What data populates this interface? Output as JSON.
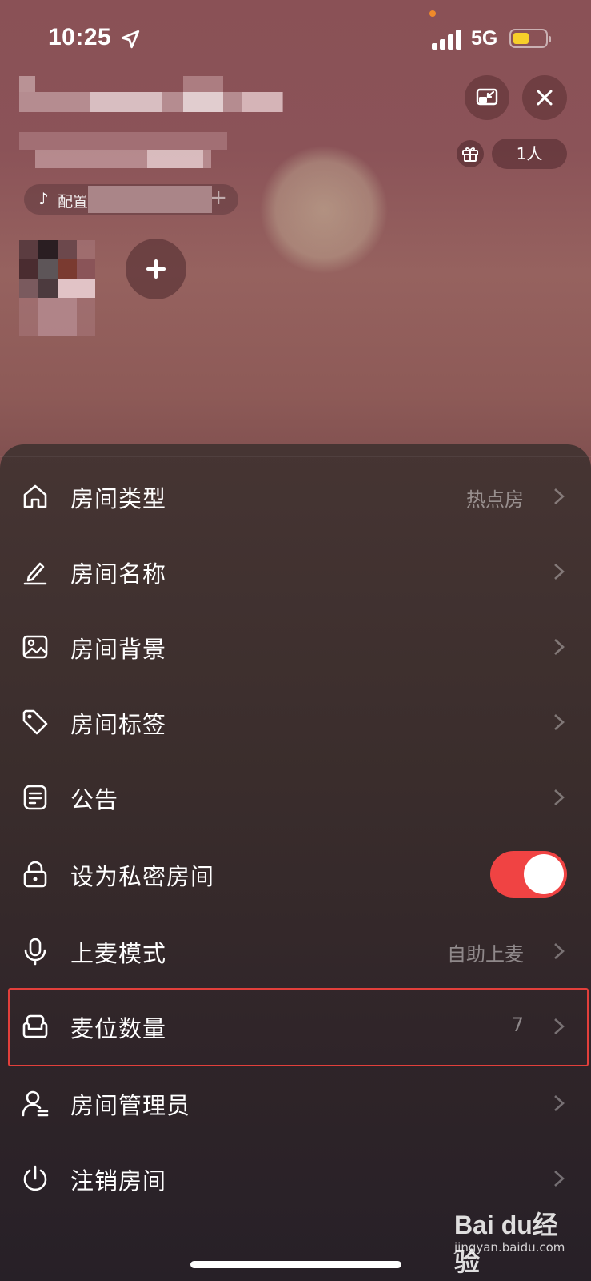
{
  "status_bar": {
    "time": "10:25",
    "network": "5G",
    "battery_level": 0.4,
    "battery_color": "#f7cf2a"
  },
  "header": {
    "music_label": "配置",
    "online_count": "1人"
  },
  "menu": {
    "items": [
      {
        "label": "房间类型",
        "value": "热点房",
        "icon": "home-icon"
      },
      {
        "label": "房间名称",
        "value": "",
        "icon": "pencil-icon"
      },
      {
        "label": "房间背景",
        "value": "",
        "icon": "image-icon"
      },
      {
        "label": "房间标签",
        "value": "",
        "icon": "tag-icon"
      },
      {
        "label": "公告",
        "value": "",
        "icon": "notice-icon"
      },
      {
        "label": "设为私密房间",
        "toggle": true,
        "icon": "lock-icon"
      },
      {
        "label": "上麦模式",
        "value": "自助上麦",
        "icon": "mic-icon"
      },
      {
        "label": "麦位数量",
        "value": "7",
        "icon": "sofa-icon",
        "highlighted": true
      },
      {
        "label": "房间管理员",
        "value": "",
        "icon": "admin-icon"
      },
      {
        "label": "注销房间",
        "value": "",
        "icon": "power-icon"
      }
    ],
    "toggle_color": "#f04343",
    "highlight_color": "#e33f3b"
  },
  "watermark": {
    "logo": "Bai du经验",
    "url": "jingyan.baidu.com"
  }
}
